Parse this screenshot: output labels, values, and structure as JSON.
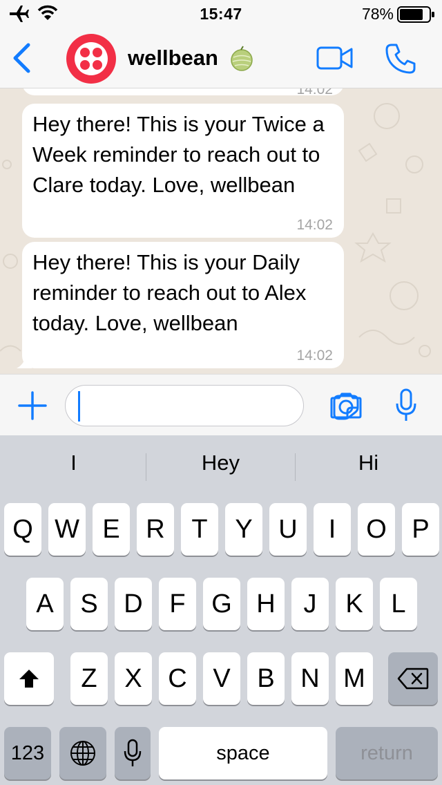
{
  "status_bar": {
    "time": "15:47",
    "battery_percent": "78%",
    "icons": [
      "airplane-icon",
      "wifi-icon",
      "battery-icon"
    ]
  },
  "header": {
    "back_icon": "chevron-left-icon",
    "contact_name": "wellbean",
    "contact_emoji": "melon",
    "video_icon": "video-camera-icon",
    "phone_icon": "phone-icon"
  },
  "messages": [
    {
      "text": "Hey there! This is your Twice a Week reminder to reach out to Clare today. Love, wellbean",
      "time": "14:02"
    },
    {
      "text": "Hey there! This is your Daily reminder to reach out to Alex today. Love, wellbean",
      "time": "14:02"
    }
  ],
  "previous_message": {
    "time": "14:02"
  },
  "composer": {
    "value": "",
    "placeholder": "",
    "icons": [
      "plus-icon",
      "sticker-icon",
      "camera-icon",
      "microphone-icon"
    ]
  },
  "keyboard": {
    "suggestions": [
      "I",
      "Hey",
      "Hi"
    ],
    "row1": [
      "Q",
      "W",
      "E",
      "R",
      "T",
      "Y",
      "U",
      "I",
      "O",
      "P"
    ],
    "row2": [
      "A",
      "S",
      "D",
      "F",
      "G",
      "H",
      "J",
      "K",
      "L"
    ],
    "row3": [
      "Z",
      "X",
      "C",
      "V",
      "B",
      "N",
      "M"
    ],
    "numbers_label": "123",
    "space_label": "space",
    "return_label": "return"
  },
  "colors": {
    "accent": "#127cff",
    "chat_background": "#ece5dc",
    "avatar": "#f22f46",
    "keyboard_background": "#d2d5db"
  }
}
